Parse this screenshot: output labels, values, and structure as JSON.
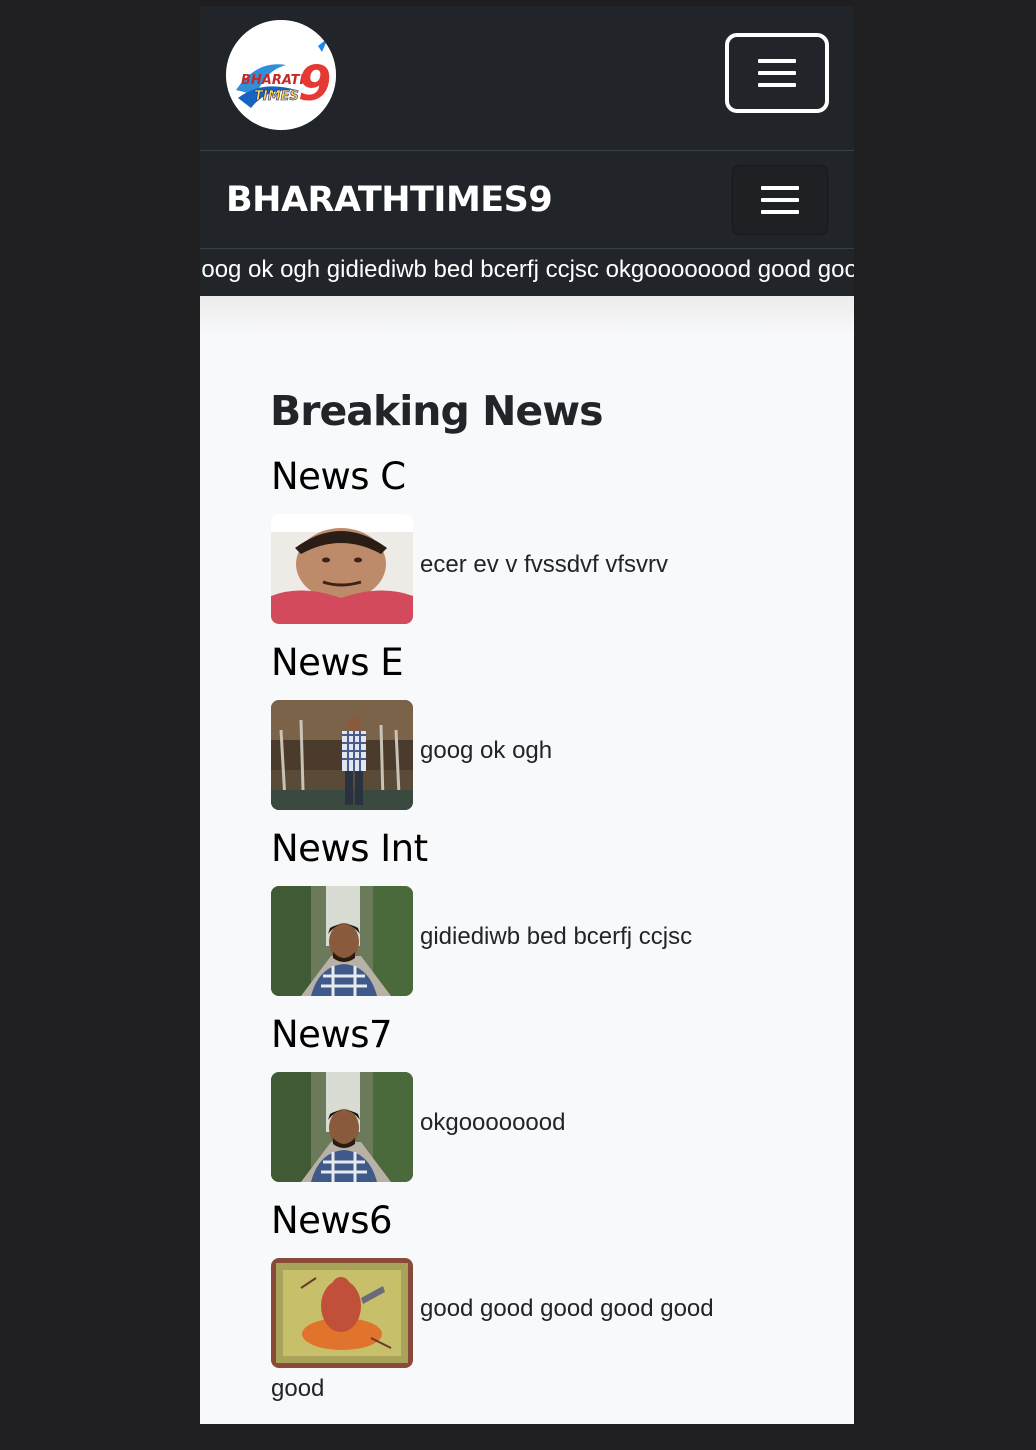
{
  "header": {
    "logo_text_top": "BHARATH",
    "logo_text_bottom": "TIMES",
    "logo_numeral": "9",
    "brand": "BHARATHTIMES9"
  },
  "ticker": {
    "text": "goog ok ogh gidiediwb bed bcerfj ccjsc okgoooooood good good good good good good"
  },
  "section": {
    "title": "Breaking News"
  },
  "news": [
    {
      "heading": "News C",
      "summary": "ecer ev v fvssdvf vfsvrv"
    },
    {
      "heading": "News E",
      "summary": "goog ok ogh"
    },
    {
      "heading": "News Int",
      "summary": "gidiediwb bed bcerfj ccjsc"
    },
    {
      "heading": "News7",
      "summary": "okgoooooood"
    },
    {
      "heading": "News6",
      "summary": "good good good good good"
    }
  ],
  "last_item_overflow": "good",
  "icons": {
    "menu": "hamburger-menu-icon"
  }
}
